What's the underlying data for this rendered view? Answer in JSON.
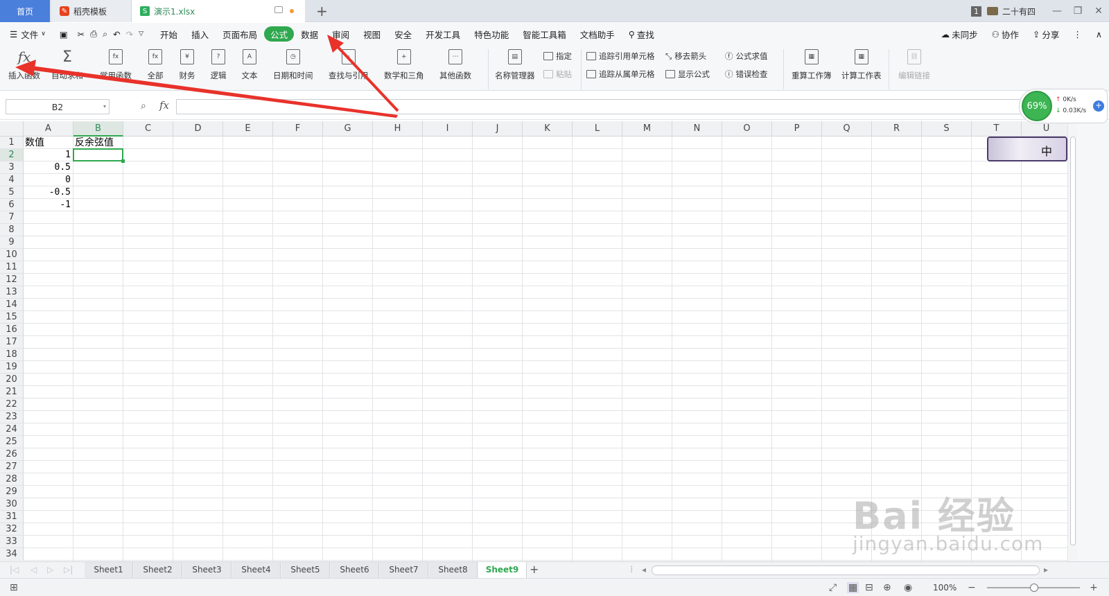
{
  "tabs": {
    "home": "首页",
    "template": "稻壳模板",
    "file": "演示1.xlsx",
    "add": "+"
  },
  "window": {
    "badge": "1",
    "user": "二十有四",
    "minimize": "—",
    "restore": "❐",
    "close": "✕"
  },
  "menu": {
    "file": "文件",
    "items": [
      "开始",
      "插入",
      "页面布局",
      "公式",
      "数据",
      "审阅",
      "视图",
      "安全",
      "开发工具",
      "特色功能",
      "智能工具箱",
      "文档助手"
    ],
    "search": "查找",
    "sync": "未同步",
    "collab": "协作",
    "share": "分享"
  },
  "ribbon": {
    "insert_function": "插入函数",
    "autosum": "自动求和",
    "common": "常用函数",
    "all": "全部",
    "finance": "财务",
    "logic": "逻辑",
    "text": "文本",
    "datetime": "日期和时间",
    "lookup": "查找与引用",
    "math": "数学和三角",
    "other": "其他函数",
    "name_manager": "名称管理器",
    "specify": "指定",
    "paste": "粘贴",
    "trace_precedents": "追踪引用单元格",
    "trace_dependents": "追踪从属单元格",
    "remove_arrows": "移去箭头",
    "show_formulas": "显示公式",
    "evaluate": "公式求值",
    "error_check": "错误检查",
    "recalc_workbook": "重算工作簿",
    "calc_sheet": "计算工作表",
    "edit_links": "编辑链接"
  },
  "formula_bar": {
    "name_box": "B2",
    "fx": "fx",
    "value": ""
  },
  "columns": [
    "A",
    "B",
    "C",
    "D",
    "E",
    "F",
    "G",
    "H",
    "I",
    "J",
    "K",
    "L",
    "M",
    "N",
    "O",
    "P",
    "Q",
    "R",
    "S",
    "T",
    "U"
  ],
  "rows": [
    "1",
    "2",
    "3",
    "4",
    "5",
    "6",
    "7",
    "8",
    "9",
    "10",
    "11",
    "12",
    "13",
    "14",
    "15",
    "16",
    "17",
    "18",
    "19",
    "20",
    "21",
    "22",
    "23",
    "24",
    "25",
    "26",
    "27",
    "28",
    "29",
    "30",
    "31",
    "32",
    "33",
    "34"
  ],
  "cells": {
    "A1": "数值",
    "B1": "反余弦值",
    "A2": "1",
    "A3": "0.5",
    "A4": "0",
    "A5": "-0.5",
    "A6": "-1"
  },
  "selected_cell": "B2",
  "sheets": [
    "Sheet1",
    "Sheet2",
    "Sheet3",
    "Sheet4",
    "Sheet5",
    "Sheet6",
    "Sheet7",
    "Sheet8",
    "Sheet9"
  ],
  "active_sheet": "Sheet9",
  "status": {
    "zoom": "100%"
  },
  "network": {
    "percent": "69%",
    "up": "0K/s",
    "down": "0.03K/s"
  },
  "ime": "中",
  "watermark": {
    "brand": "Bai 经验",
    "url": "jingyan.baidu.com"
  },
  "colors": {
    "accent": "#2fa84f",
    "home_tab": "#4a7fdc",
    "arrow": "#e8322a"
  }
}
